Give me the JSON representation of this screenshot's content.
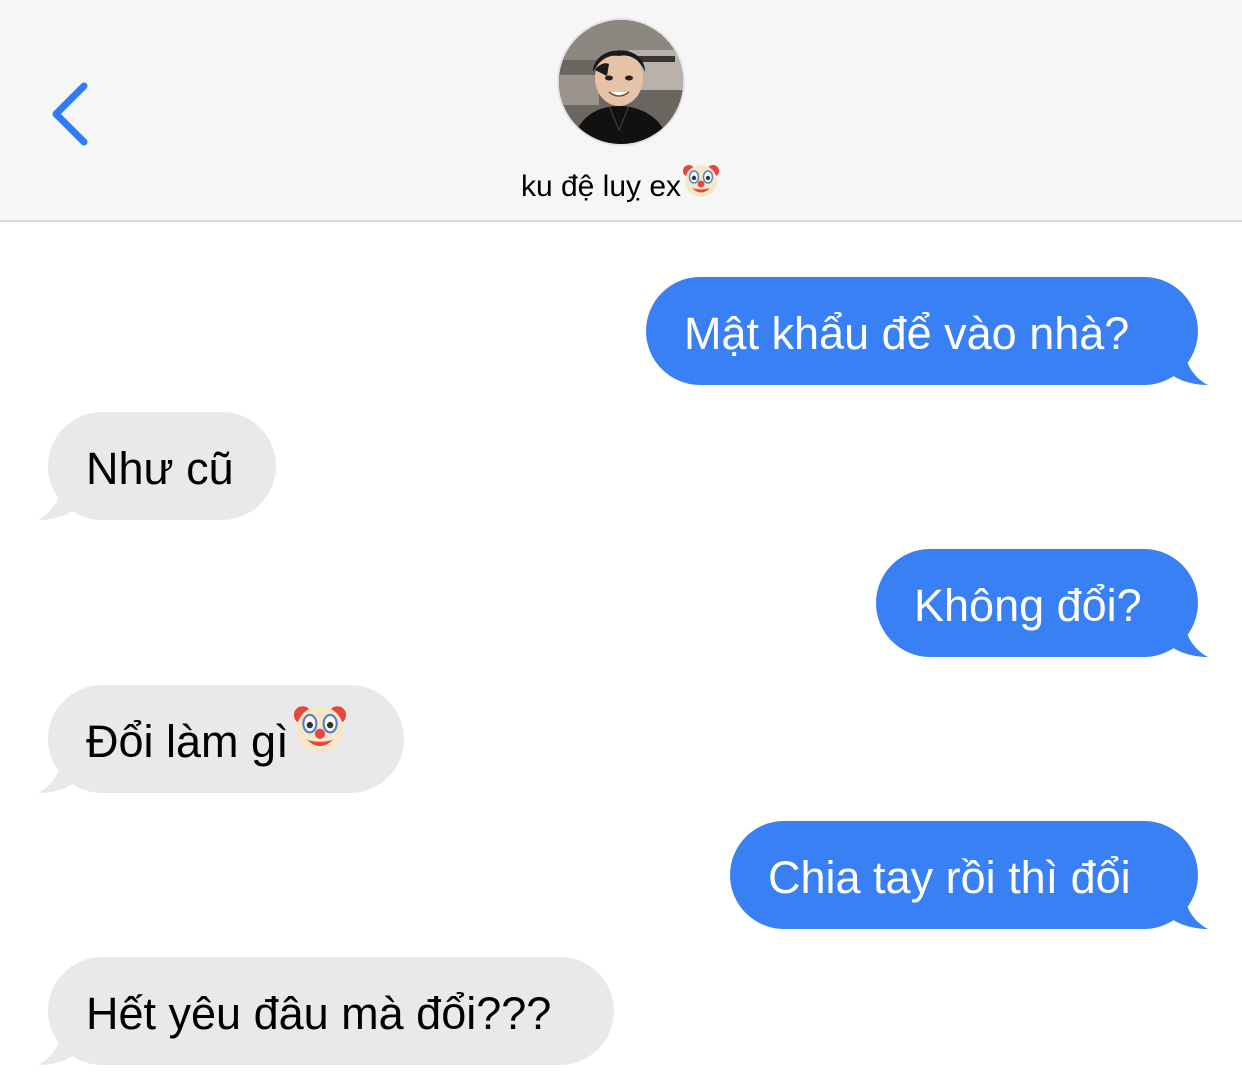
{
  "header": {
    "contact_name": "ku đệ luỵ ex",
    "contact_emoji": "clown-face-icon"
  },
  "colors": {
    "sent_bubble": "#3a80f5",
    "received_bubble": "#e9e9eb",
    "back_chevron": "#2f7cf6",
    "header_bg": "#f6f6f6"
  },
  "messages": [
    {
      "direction": "sent",
      "text": "Mật khẩu để vào nhà?"
    },
    {
      "direction": "received",
      "text": "Như cũ"
    },
    {
      "direction": "sent",
      "text": "Không đổi?"
    },
    {
      "direction": "received",
      "text": "Đổi làm gì",
      "emoji": "clown-face-icon"
    },
    {
      "direction": "sent",
      "text": "Chia tay rồi thì đổi"
    },
    {
      "direction": "received",
      "text": "Hết yêu đâu mà đổi???"
    }
  ]
}
